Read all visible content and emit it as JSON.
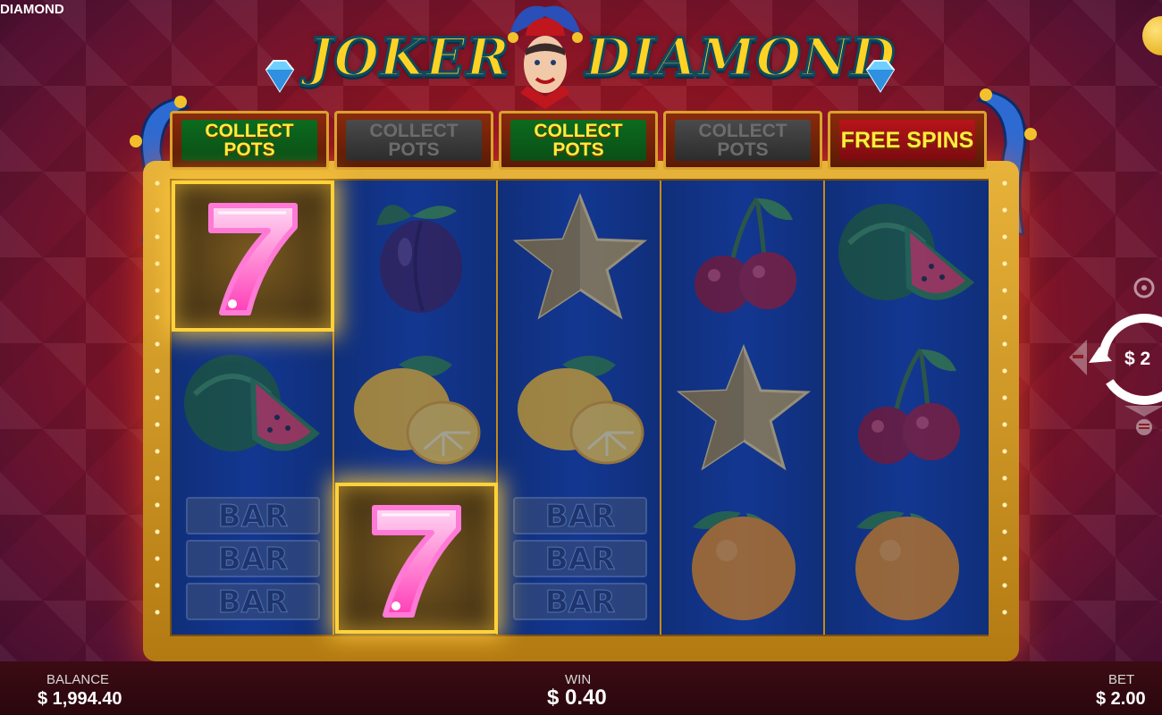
{
  "game": {
    "title_fragment": "DIAMOND",
    "logo_left": "JOKER",
    "logo_right": "DIAMOND"
  },
  "headers": [
    {
      "line1": "COLLECT",
      "line2": "POTS",
      "state": "active"
    },
    {
      "line1": "COLLECT",
      "line2": "POTS",
      "state": "inactive"
    },
    {
      "line1": "COLLECT",
      "line2": "POTS",
      "state": "active"
    },
    {
      "line1": "COLLECT",
      "line2": "POTS",
      "state": "inactive"
    },
    {
      "line1": "FREE SPINS",
      "line2": "",
      "state": "freespins"
    }
  ],
  "reels": [
    [
      "seven",
      "watermelon",
      "bar"
    ],
    [
      "plum",
      "lemon",
      "seven"
    ],
    [
      "star",
      "lemon",
      "bar"
    ],
    [
      "cherry",
      "star",
      "orange"
    ],
    [
      "watermelon",
      "cherry",
      "orange"
    ]
  ],
  "winning_cells": [
    [
      0,
      0
    ],
    [
      1,
      2
    ]
  ],
  "bet_control": {
    "value": "$ 2",
    "icons": [
      "autoplay-icon",
      "minus-icon",
      "spin-icon",
      "plus-icon",
      "menu-icon"
    ]
  },
  "bottom": {
    "balance_label": "BALANCE",
    "balance_value": "$ 1,994.40",
    "win_label": "WIN",
    "win_value": "$ 0.40",
    "bet_label": "BET",
    "bet_value": "$ 2.00"
  },
  "colors": {
    "accent_gold": "#ffd324",
    "reel_blue": "#133791",
    "header_green": "#0c6b1e",
    "header_red": "#b8141a",
    "seven_pink": "#ff4fc4"
  }
}
